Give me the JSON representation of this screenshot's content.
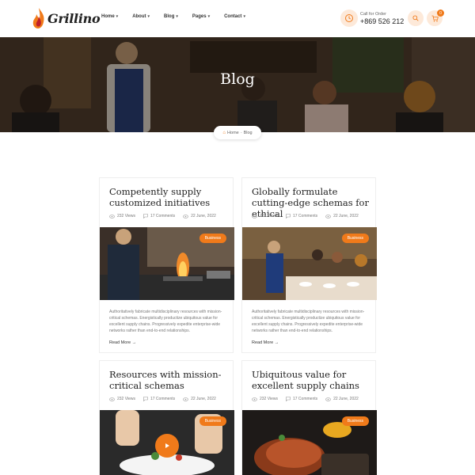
{
  "brand": {
    "name": "Grillino",
    "accent": "#f07a1a"
  },
  "nav": [
    {
      "label": "Home"
    },
    {
      "label": "About"
    },
    {
      "label": "Blog"
    },
    {
      "label": "Pages"
    },
    {
      "label": "Contact"
    }
  ],
  "call": {
    "label": "Call for Order",
    "number": "+869 526 212"
  },
  "cart": {
    "count": "0"
  },
  "hero": {
    "title": "Blog"
  },
  "breadcrumb": {
    "home": "Home",
    "separator": "-",
    "current": "Blog"
  },
  "posts": [
    {
      "title": "Competently supply customized initiatives",
      "views": "232 Views",
      "comments": "17 Comments",
      "date": "22 June, 2022",
      "category": "Business",
      "excerpt": "Authoritatively fabricate multidisciplinary resources with mission-critical schemas. Energistically productize ubiquitous value for excellent supply chains. Progressively expedite enterprise-wide networks rather than end-to-end relationships.",
      "read_more": "Read More →"
    },
    {
      "title": "Globally formulate cutting-edge schemas for ethical",
      "views": "232 Views",
      "comments": "17 Comments",
      "date": "22 June, 2022",
      "category": "Business",
      "excerpt": "Authoritatively fabricate multidisciplinary resources with mission-critical schemas. Energistically productize ubiquitous value for excellent supply chains. Progressively expedite enterprise-wide networks rather than end-to-end relationships.",
      "read_more": "Read More →"
    },
    {
      "title": "Resources with mission-critical schemas",
      "views": "232 Views",
      "comments": "17 Comments",
      "date": "22 June, 2022",
      "category": "Business"
    },
    {
      "title": "Ubiquitous value for excellent supply chains",
      "views": "232 Views",
      "comments": "17 Comments",
      "date": "22 June, 2022",
      "category": "Business"
    }
  ]
}
